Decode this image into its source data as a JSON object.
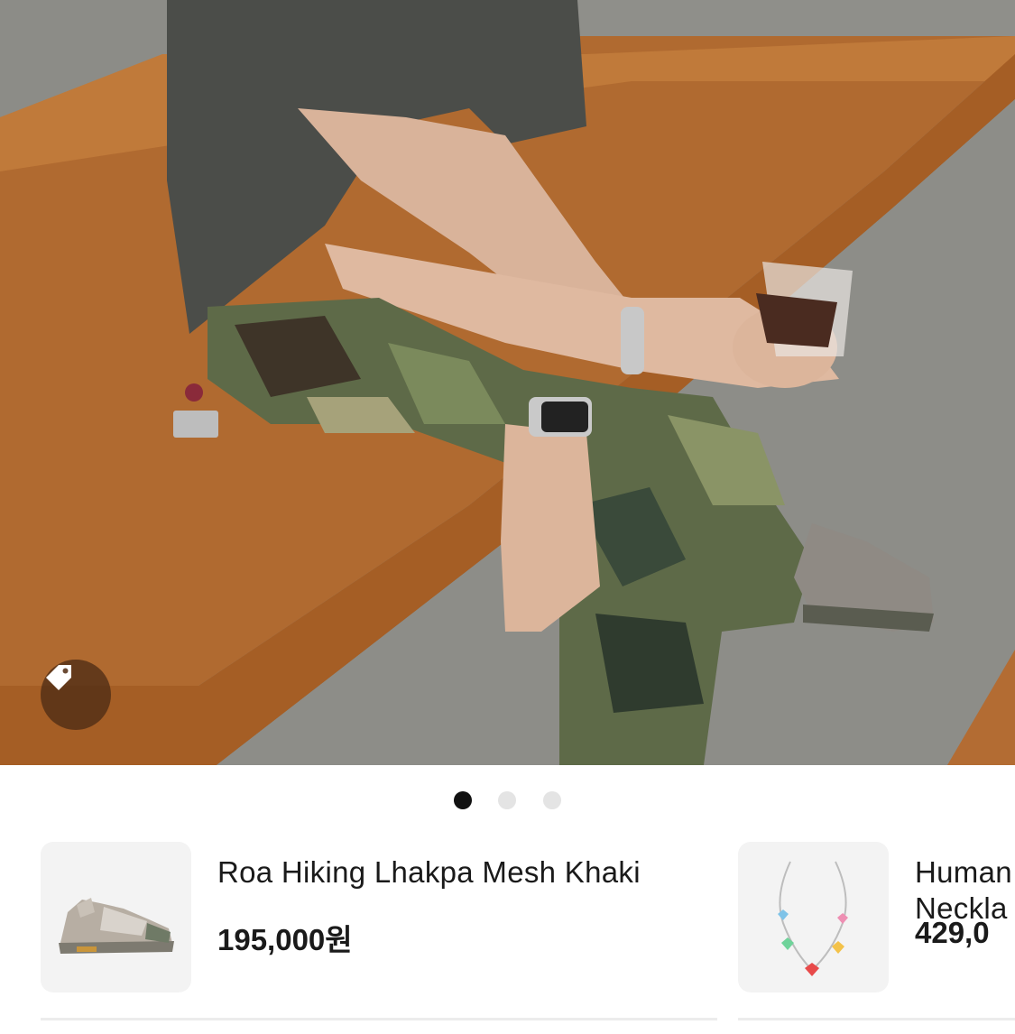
{
  "carousel": {
    "page_count": 3,
    "active_index": 0
  },
  "photo": {
    "tag_icon": "tag-icon"
  },
  "products": [
    {
      "name": "Roa Hiking Lhakpa Mesh Khaki",
      "price": "195,000원",
      "thumb_icon": "sneaker-image"
    },
    {
      "name": "Human\nNeckla",
      "price": "429,0",
      "thumb_icon": "necklace-image"
    }
  ],
  "colors": {
    "accent_dot_active": "#111111",
    "dot_inactive": "#e4e4e4",
    "text": "#1a1a1a"
  }
}
